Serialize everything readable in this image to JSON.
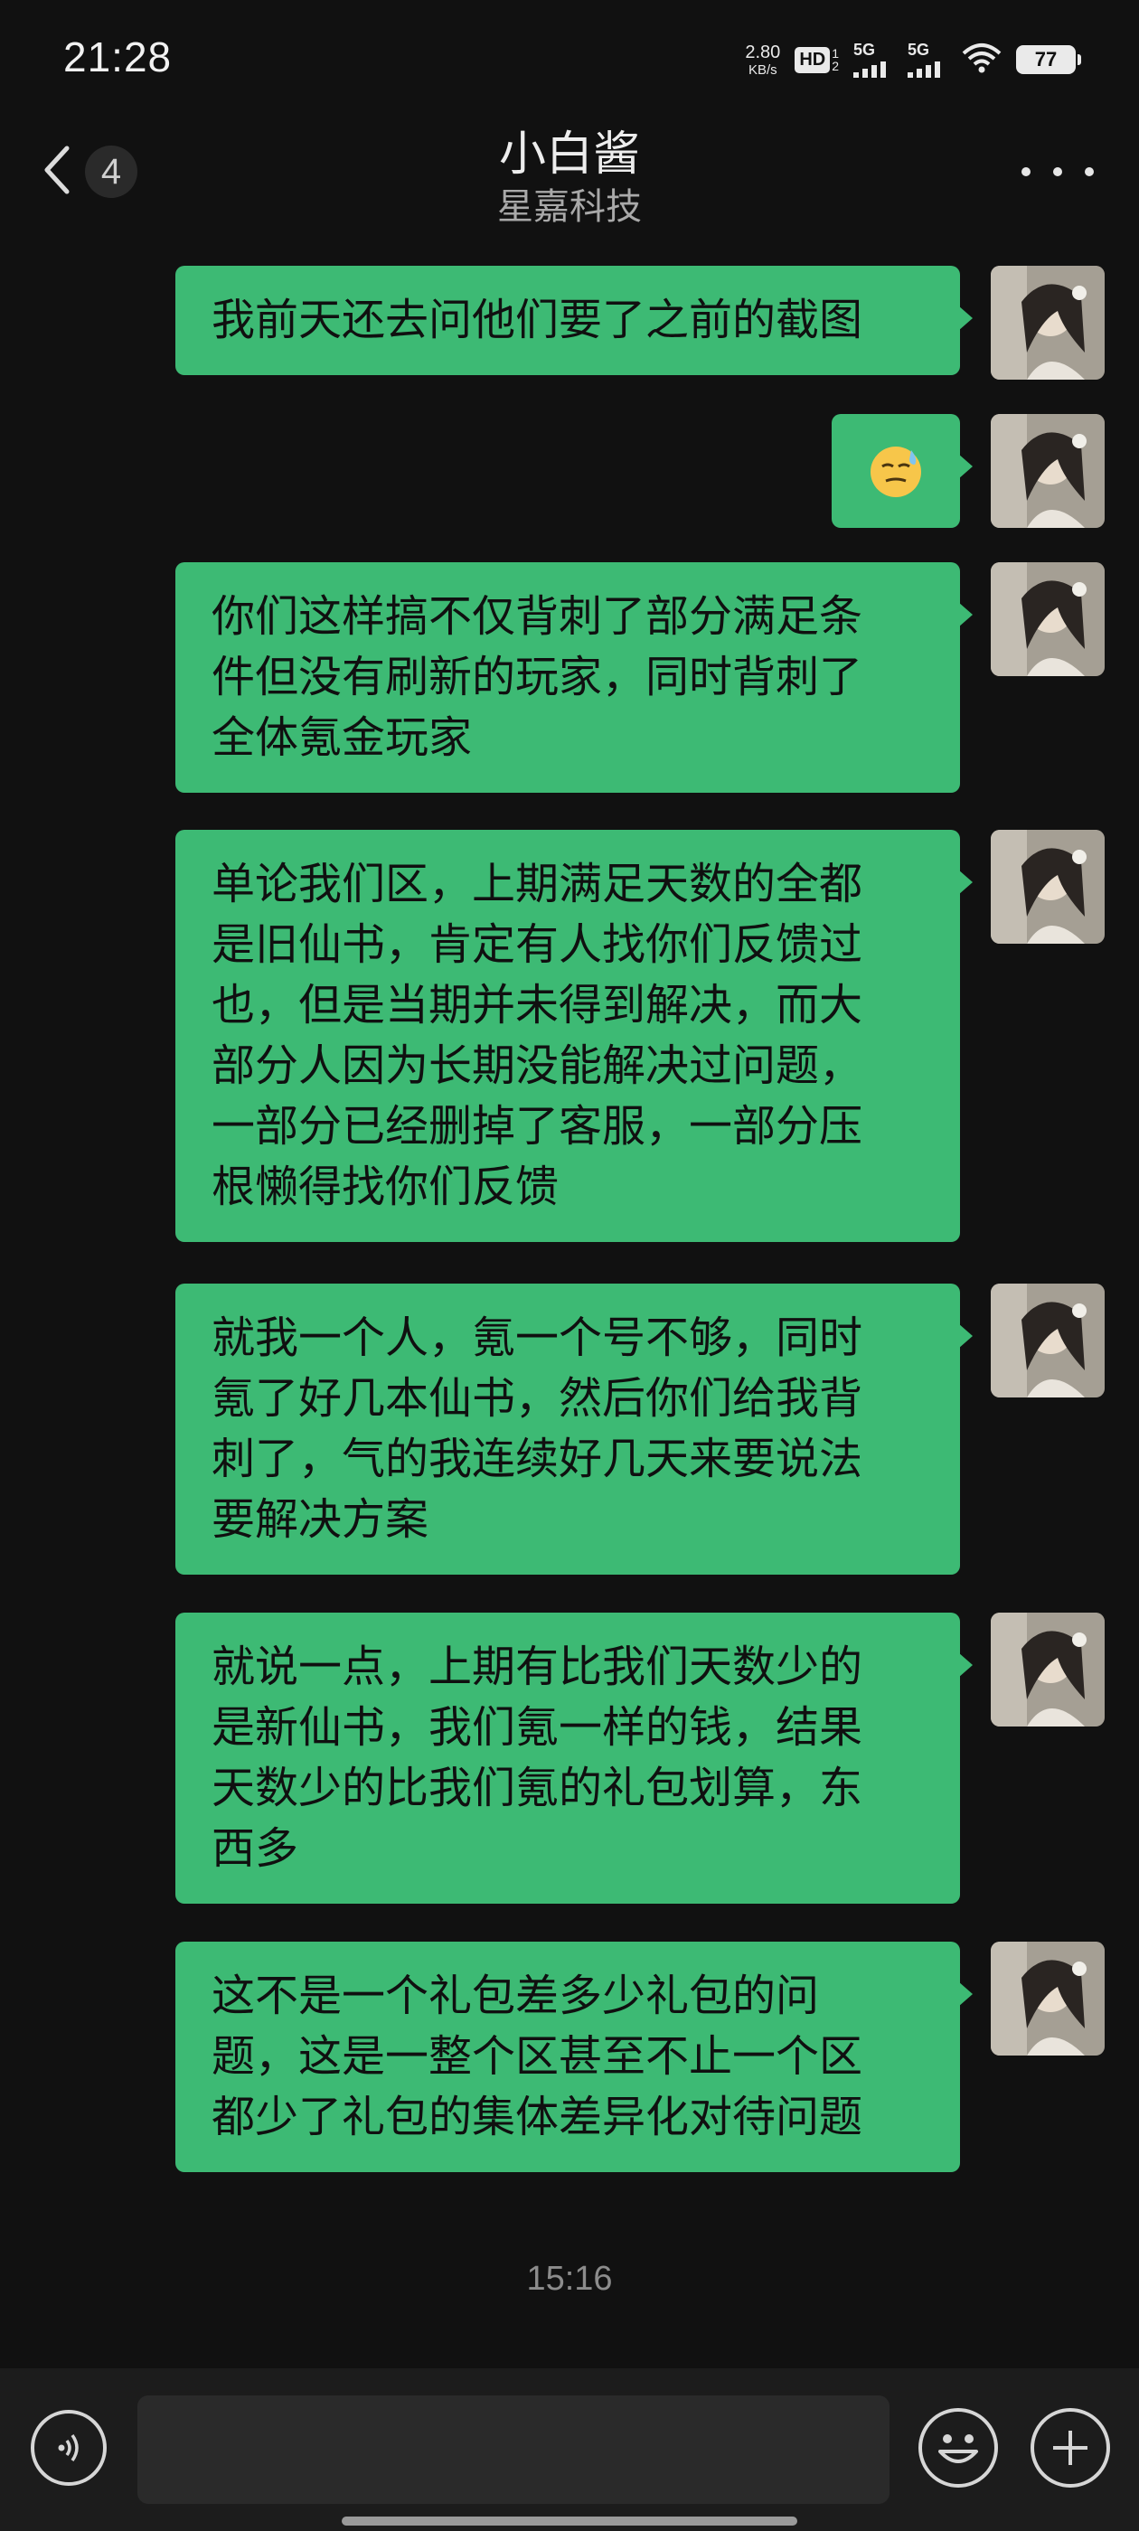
{
  "status_bar": {
    "time": "21:28",
    "net_speed_value": "2.80",
    "net_speed_unit": "KB/s",
    "hd_label": "HD",
    "hd_sub_top": "1",
    "hd_sub_bottom": "2",
    "sim1_label": "5G",
    "sim2_label": "5G",
    "battery_level": "77",
    "icons": [
      "hd-voice-icon",
      "signal-5g-icon",
      "signal-5g-icon",
      "wifi-icon",
      "battery-icon"
    ]
  },
  "header": {
    "back_count": "4",
    "title": "小白酱",
    "subtitle": "星嘉科技",
    "icons": [
      "back-chevron-icon",
      "more-dots-icon"
    ]
  },
  "messages": [
    {
      "type": "text",
      "lines": [
        "我前天还去问他们要了之前的截图"
      ]
    },
    {
      "type": "emoji",
      "emoji": "sweat-smile-emoji"
    },
    {
      "type": "text",
      "lines": [
        "你们这样搞不仅背刺了部分满足条",
        "件但没有刷新的玩家，同时背刺了",
        "全体氪金玩家"
      ]
    },
    {
      "type": "text",
      "lines": [
        "单论我们区，上期满足天数的全都",
        "是旧仙书，肯定有人找你们反馈过",
        "也，但是当期并未得到解决，而大",
        "部分人因为长期没能解决过问题，",
        "一部分已经删掉了客服，一部分压",
        "根懒得找你们反馈"
      ]
    },
    {
      "type": "text",
      "lines": [
        "就我一个人，氪一个号不够，同时",
        "氪了好几本仙书，然后你们给我背",
        "刺了，气的我连续好几天来要说法",
        "要解决方案"
      ]
    },
    {
      "type": "text",
      "lines": [
        "就说一点，上期有比我们天数少的",
        "是新仙书，我们氪一样的钱，结果",
        "天数少的比我们氪的礼包划算，东",
        "西多"
      ]
    },
    {
      "type": "text",
      "lines": [
        "这不是一个礼包差多少礼包的问",
        "题，这是一整个区甚至不止一个区",
        "都少了礼包的集体差异化对待问题"
      ]
    }
  ],
  "timestamp": "15:16",
  "input_bar": {
    "value": "",
    "icons": [
      "voice-icon",
      "emoji-icon",
      "plus-icon"
    ]
  },
  "colors": {
    "background": "#111111",
    "bubble": "#3dba74",
    "bubble_text": "#101010",
    "input_bar": "#1c1c1c"
  }
}
